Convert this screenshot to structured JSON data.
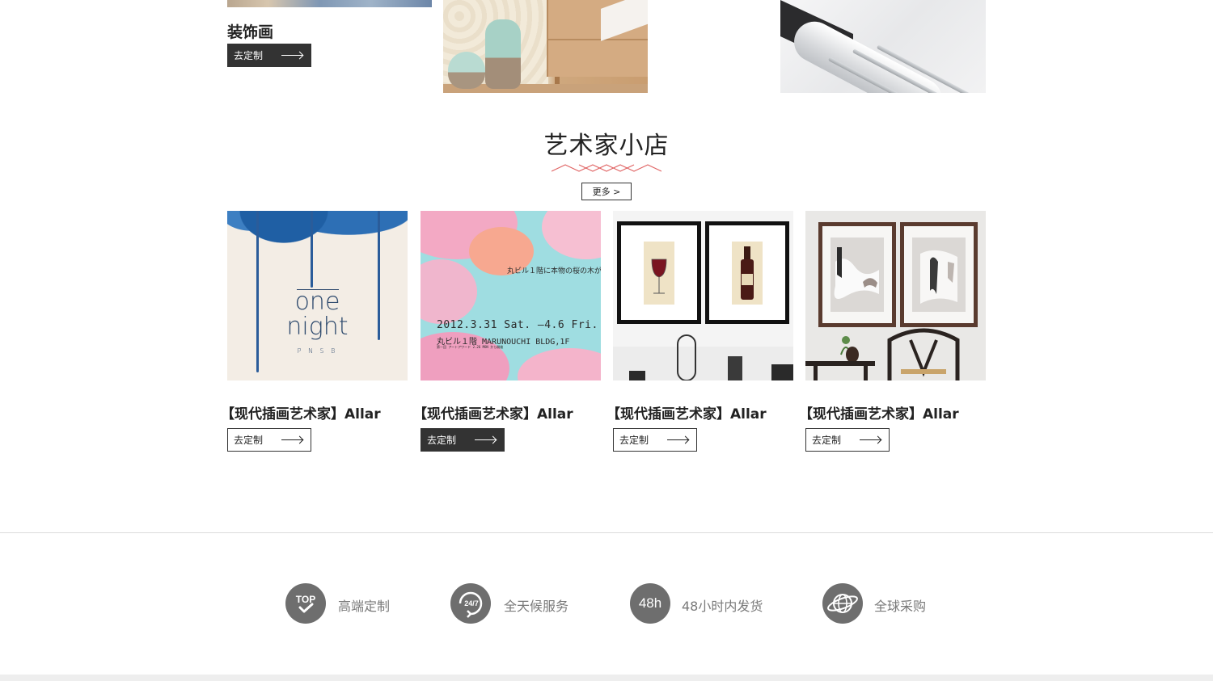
{
  "top_products": {
    "title": "装饰画",
    "button_label": "去定制"
  },
  "artist_section": {
    "title": "艺术家小店",
    "more_label": "更多 >",
    "cards": [
      {
        "title": "【现代插画艺术家】Allar",
        "button_label": "去定制",
        "image_text": [
          "one",
          "night",
          "P N S B"
        ]
      },
      {
        "title": "【现代插画艺术家】Allar",
        "button_label": "去定制",
        "image_text": [
          "丸ビル１階に本物の桜の木が",
          "2012.3.31 Sat. ―4.6 Fri.",
          "丸ビル１階 MARUNOUCHI BLDG,1F",
          "第一回 アートアワード 2.26 MON から開催"
        ]
      },
      {
        "title": "【现代插画艺术家】Allar",
        "button_label": "去定制"
      },
      {
        "title": "【现代插画艺术家】Allar",
        "button_label": "去定制"
      }
    ]
  },
  "features": [
    {
      "icon": "top-check-icon",
      "icon_text": "TOP",
      "label": "高端定制"
    },
    {
      "icon": "24-7-service-icon",
      "icon_text": "24/7",
      "label": "全天候服务"
    },
    {
      "icon": "48h-icon",
      "icon_text": "48h",
      "label": "48小时内发货"
    },
    {
      "icon": "globe-icon",
      "icon_text": "",
      "label": "全球采购"
    }
  ],
  "colors": {
    "dark_button": "#333333",
    "accent_zigzag": "#e06464",
    "feature_icon": "#6e6e6e",
    "feature_text": "#7a7a7a"
  }
}
